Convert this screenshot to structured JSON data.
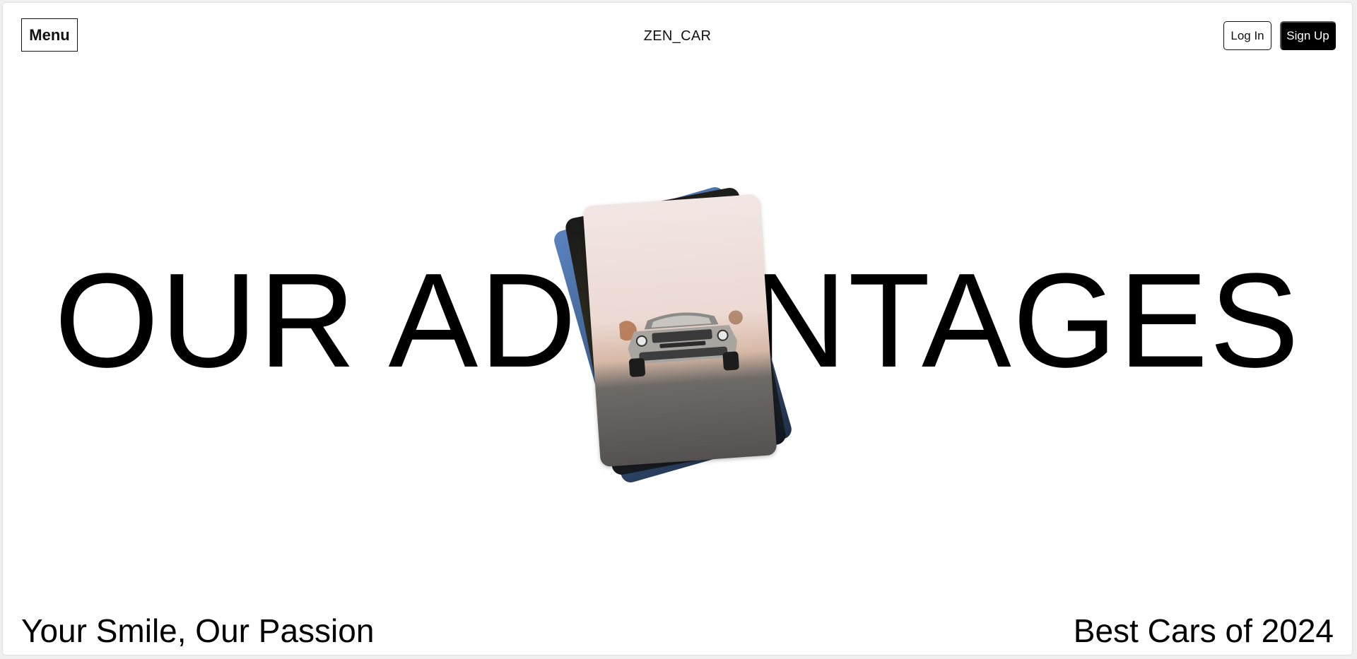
{
  "header": {
    "menu_label": "Menu",
    "brand": "ZEN_CAR",
    "login_label": "Log In",
    "signup_label": "Sign Up"
  },
  "hero": {
    "title": "OUR ADVANTAGES",
    "cards": [
      {
        "icon": "car-photo-front",
        "description_shown": ""
      },
      {
        "icon": "photo-card-dark",
        "description_shown": ""
      },
      {
        "icon": "photo-card-blue",
        "description_shown": ""
      }
    ]
  },
  "footer": {
    "tagline": "Your Smile, Our Passion",
    "highlight": "Best Cars of 2024"
  },
  "colors": {
    "background": "#ffffff",
    "text": "#000000",
    "signup_bg": "#000000",
    "signup_text": "#ffffff"
  }
}
